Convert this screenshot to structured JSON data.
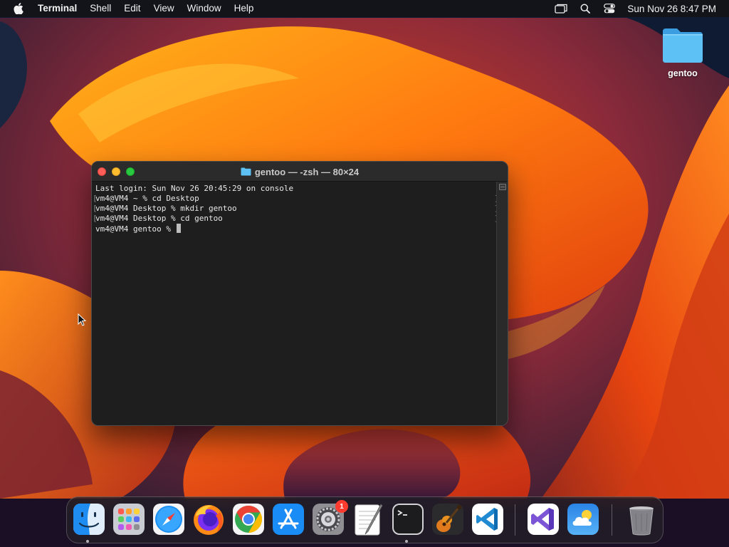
{
  "menubar": {
    "app_name": "Terminal",
    "menus": [
      "Shell",
      "Edit",
      "View",
      "Window",
      "Help"
    ],
    "status_icons": [
      "screen-mirroring-icon",
      "spotlight-search-icon",
      "control-center-icon"
    ],
    "clock": "Sun Nov 26  8:47 PM"
  },
  "desktop": {
    "folder_label": "gentoo"
  },
  "terminal": {
    "title": "gentoo — -zsh — 80×24",
    "lines": [
      "Last login: Sun Nov 26 20:45:29 on console",
      "vm4@VM4 ~ % cd Desktop",
      "vm4@VM4 Desktop % mkdir gentoo",
      "vm4@VM4 Desktop % cd gentoo",
      "vm4@VM4 gentoo % "
    ]
  },
  "dock": {
    "apps": [
      {
        "name": "Finder",
        "icon": "finder-icon",
        "running": true
      },
      {
        "name": "Launchpad",
        "icon": "launchpad-icon",
        "running": false
      },
      {
        "name": "Safari",
        "icon": "safari-icon",
        "running": false
      },
      {
        "name": "Firefox",
        "icon": "firefox-icon",
        "running": false
      },
      {
        "name": "Google Chrome",
        "icon": "chrome-icon",
        "running": false
      },
      {
        "name": "App Store",
        "icon": "app-store-icon",
        "running": false
      },
      {
        "name": "System Settings",
        "icon": "system-settings-icon",
        "running": false,
        "badge": "1"
      },
      {
        "name": "TextEdit",
        "icon": "textedit-icon",
        "running": false
      },
      {
        "name": "Terminal",
        "icon": "terminal-icon",
        "running": true
      },
      {
        "name": "GarageBand",
        "icon": "garageband-icon",
        "running": false
      },
      {
        "name": "Visual Studio Code",
        "icon": "vscode-icon",
        "running": false
      },
      {
        "name": "Visual Studio",
        "icon": "visual-studio-icon",
        "running": false
      },
      {
        "name": "Weather",
        "icon": "weather-icon",
        "running": false
      },
      {
        "name": "Trash",
        "icon": "trash-icon",
        "running": false
      }
    ]
  },
  "colors": {
    "close": "#ff5f57",
    "minimize": "#febc2e",
    "maximize": "#28c840",
    "badge": "#ff3b30",
    "folder": "#4fb3ef"
  }
}
